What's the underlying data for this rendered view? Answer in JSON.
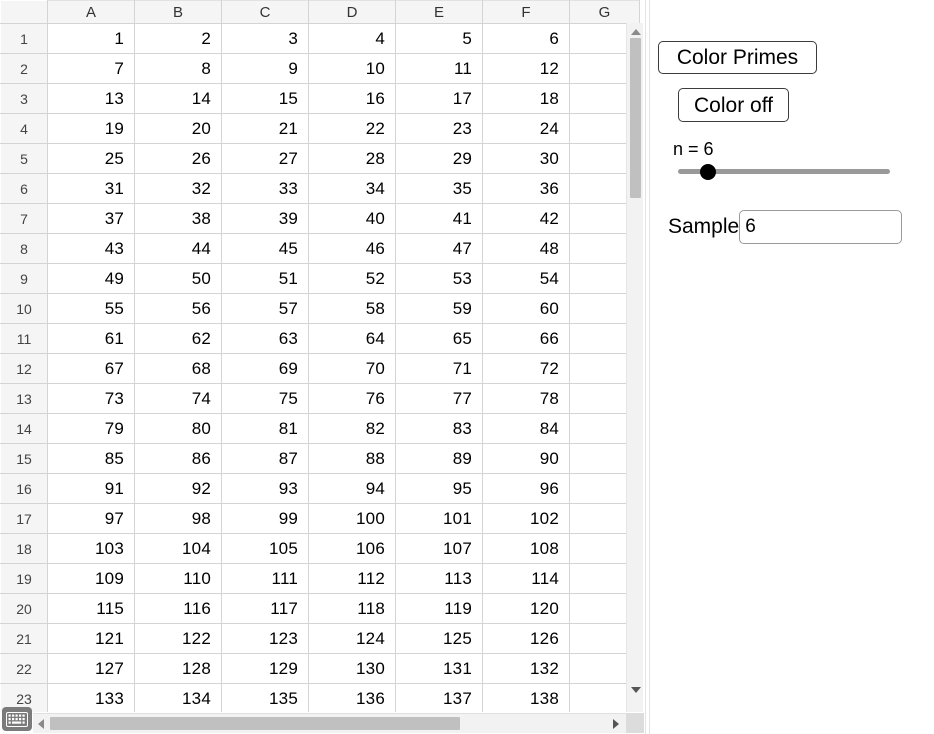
{
  "spreadsheet": {
    "column_headers": [
      "A",
      "B",
      "C",
      "D",
      "E",
      "F",
      "G"
    ],
    "row_headers": [
      "1",
      "2",
      "3",
      "4",
      "5",
      "6",
      "7",
      "8",
      "9",
      "10",
      "11",
      "12",
      "13",
      "14",
      "15",
      "16",
      "17",
      "18",
      "19",
      "20",
      "21",
      "22",
      "23"
    ],
    "rows": [
      [
        "1",
        "2",
        "3",
        "4",
        "5",
        "6",
        ""
      ],
      [
        "7",
        "8",
        "9",
        "10",
        "11",
        "12",
        ""
      ],
      [
        "13",
        "14",
        "15",
        "16",
        "17",
        "18",
        ""
      ],
      [
        "19",
        "20",
        "21",
        "22",
        "23",
        "24",
        ""
      ],
      [
        "25",
        "26",
        "27",
        "28",
        "29",
        "30",
        ""
      ],
      [
        "31",
        "32",
        "33",
        "34",
        "35",
        "36",
        ""
      ],
      [
        "37",
        "38",
        "39",
        "40",
        "41",
        "42",
        ""
      ],
      [
        "43",
        "44",
        "45",
        "46",
        "47",
        "48",
        ""
      ],
      [
        "49",
        "50",
        "51",
        "52",
        "53",
        "54",
        ""
      ],
      [
        "55",
        "56",
        "57",
        "58",
        "59",
        "60",
        ""
      ],
      [
        "61",
        "62",
        "63",
        "64",
        "65",
        "66",
        ""
      ],
      [
        "67",
        "68",
        "69",
        "70",
        "71",
        "72",
        ""
      ],
      [
        "73",
        "74",
        "75",
        "76",
        "77",
        "78",
        ""
      ],
      [
        "79",
        "80",
        "81",
        "82",
        "83",
        "84",
        ""
      ],
      [
        "85",
        "86",
        "87",
        "88",
        "89",
        "90",
        ""
      ],
      [
        "91",
        "92",
        "93",
        "94",
        "95",
        "96",
        ""
      ],
      [
        "97",
        "98",
        "99",
        "100",
        "101",
        "102",
        ""
      ],
      [
        "103",
        "104",
        "105",
        "106",
        "107",
        "108",
        ""
      ],
      [
        "109",
        "110",
        "111",
        "112",
        "113",
        "114",
        ""
      ],
      [
        "115",
        "116",
        "117",
        "118",
        "119",
        "120",
        ""
      ],
      [
        "121",
        "122",
        "123",
        "124",
        "125",
        "126",
        ""
      ],
      [
        "127",
        "128",
        "129",
        "130",
        "131",
        "132",
        ""
      ],
      [
        "133",
        "134",
        "135",
        "136",
        "137",
        "138",
        ""
      ]
    ]
  },
  "scrollbars": {
    "vertical_icon_up": "triangle-up-icon",
    "vertical_icon_down": "triangle-down-icon",
    "horizontal_icon_left": "triangle-left-icon",
    "horizontal_icon_right": "triangle-right-icon"
  },
  "keyboard_toggle": {
    "icon": "keyboard-icon"
  },
  "controls": {
    "color_primes_label": "Color Primes",
    "color_off_label": "Color off",
    "slider_label": "n = 6",
    "slider_value": 6,
    "slider_min": 1,
    "slider_max": 100,
    "sample_label": "Sample",
    "sample_value": "6",
    "sample_placeholder": ""
  },
  "colors": {
    "grid_line": "#d4d4d4",
    "header_bg": "#f5f5f5",
    "scroll_thumb": "#c0c0c0",
    "slider_track": "#999999",
    "slider_thumb": "#000000",
    "keyboard_bg": "#7b7b7b"
  }
}
